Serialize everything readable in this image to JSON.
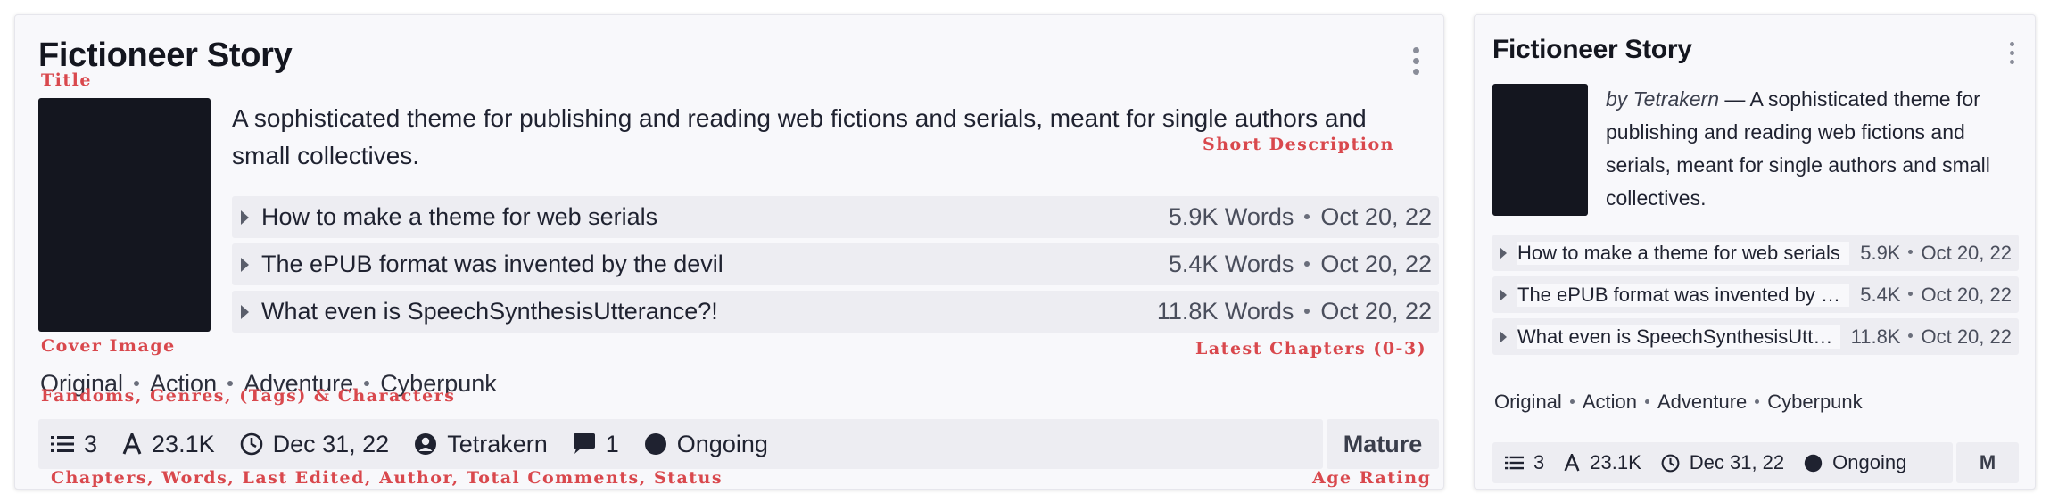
{
  "large_card": {
    "title": "Fictioneer Story",
    "description": "A sophisticated theme for publishing and reading web fictions and serials, meant for single authors and small collectives.",
    "chapters": [
      {
        "title": "How to make a theme for web serials",
        "words": "5.9K Words",
        "date": "Oct 20, 22"
      },
      {
        "title": "The ePUB format was invented by the devil",
        "words": "5.4K Words",
        "date": "Oct 20, 22"
      },
      {
        "title": "What even is SpeechSynthesisUtterance?!",
        "words": "11.8K Words",
        "date": "Oct 20, 22"
      }
    ],
    "tags": [
      "Original",
      "Action",
      "Adventure",
      "Cyberpunk"
    ],
    "stats": {
      "chapters": "3",
      "words": "23.1K",
      "edited": "Dec 31, 22",
      "author": "Tetrakern",
      "comments": "1",
      "status": "Ongoing"
    },
    "rating": "Mature"
  },
  "small_card": {
    "title": "Fictioneer Story",
    "byline": "by Tetrakern",
    "description": " — A sophisticated theme for publishing and reading web fictions and serials, meant for single authors and small collectives.",
    "chapters": [
      {
        "title": "How to make a theme for web serials",
        "words": "5.9K",
        "date": "Oct 20, 22"
      },
      {
        "title": "The ePUB format was invented by the devil",
        "words": "5.4K",
        "date": "Oct 20, 22"
      },
      {
        "title": "What even is SpeechSynthesisUtterance?!",
        "words": "11.8K",
        "date": "Oct 20, 22"
      }
    ],
    "tags": [
      "Original",
      "Action",
      "Adventure",
      "Cyberpunk"
    ],
    "stats": {
      "chapters": "3",
      "words": "23.1K",
      "edited": "Dec 31, 22",
      "status": "Ongoing"
    },
    "rating": "M"
  },
  "annotations": {
    "title": "Title",
    "short_description": "Short Description",
    "cover_image": "Cover Image",
    "latest_chapters": "Latest Chapters (0-3)",
    "taxonomies": "Fandoms, Genres, (Tags) & Characters",
    "footer_stats": "Chapters, Words, Last Edited, Author, Total Comments, Status",
    "age_rating": "Age Rating"
  },
  "icons": [
    "list-icon",
    "font-icon",
    "clock-icon",
    "user-circle-icon",
    "comment-icon",
    "status-circle-icon",
    "more-vertical-icon",
    "caret-right-icon"
  ],
  "colors": {
    "annotation": "#d9484d",
    "cover": "#14161f",
    "card_bg": "#f8f8fb",
    "row_bg": "#ededf2"
  }
}
